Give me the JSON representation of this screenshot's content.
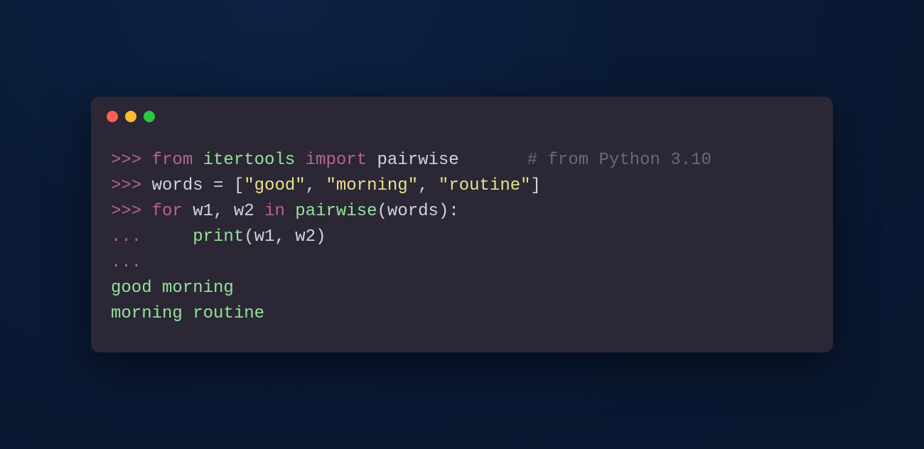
{
  "titlebar": {
    "buttons": {
      "close": "close",
      "minimize": "minimize",
      "maximize": "maximize"
    }
  },
  "code": {
    "prompt_primary": ">>> ",
    "prompt_continuation": "... ",
    "line1": {
      "kw_from": "from",
      "module": "itertools",
      "kw_import": "import",
      "target": "pairwise",
      "comment": "# from Python 3.10"
    },
    "line2": {
      "var": "words",
      "op_assign": " = ",
      "lbracket": "[",
      "str1": "\"good\"",
      "comma1": ", ",
      "str2": "\"morning\"",
      "comma2": ", ",
      "str3": "\"routine\"",
      "rbracket": "]"
    },
    "line3": {
      "kw_for": "for",
      "v1": "w1",
      "comma": ", ",
      "v2": "w2",
      "kw_in": "in",
      "func": "pairwise",
      "arg": "words",
      "paren_open": "(",
      "paren_close": "):"
    },
    "line4": {
      "indent": "    ",
      "func": "print",
      "paren_open": "(",
      "arg1": "w1",
      "comma": ", ",
      "arg2": "w2",
      "paren_close": ")"
    },
    "line5": "...",
    "output1": "good morning",
    "output2": "morning routine"
  }
}
